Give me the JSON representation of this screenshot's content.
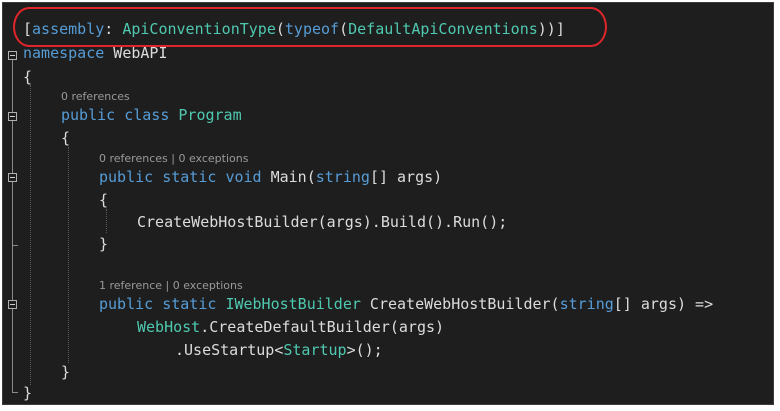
{
  "editor": {
    "line1": {
      "p1": "[",
      "p2": "assembly",
      "p3": ": ",
      "p4": "ApiConventionType",
      "p5": "(",
      "p6": "typeof",
      "p7": "(",
      "p8": "DefaultApiConventions",
      "p9": "))]"
    },
    "line2": {
      "p1": "namespace",
      "p2": " WebAPI"
    },
    "line3": "{",
    "lens_program": "0 references",
    "line4": {
      "p1": "public",
      "p2": " ",
      "p3": "class",
      "p4": " ",
      "p5": "Program"
    },
    "line5": "{",
    "lens_main": {
      "refs": "0 references",
      "sep": " | ",
      "exc": "0 exceptions"
    },
    "line6": {
      "p1": "public",
      "p2": " ",
      "p3": "static",
      "p4": " ",
      "p5": "void",
      "p6": " Main(",
      "p7": "string",
      "p8": "[] args)"
    },
    "line7": "{",
    "line8": "CreateWebHostBuilder(args).Build().Run();",
    "line9": "}",
    "lens_builder": {
      "refs": "1 reference",
      "sep": " | ",
      "exc": "0 exceptions"
    },
    "line10": {
      "p1": "public",
      "p2": " ",
      "p3": "static",
      "p4": " ",
      "p5": "IWebHostBuilder",
      "p6": " CreateWebHostBuilder(",
      "p7": "string",
      "p8": "[] args) =>"
    },
    "line11": {
      "p1": "WebHost",
      "p2": ".CreateDefaultBuilder(args)"
    },
    "line12": {
      "p1": ".UseStartup<",
      "p2": "Startup",
      "p3": ">();"
    },
    "line13": "}",
    "line14": "}"
  },
  "colors": {
    "background": "#1e1e1e",
    "keyword": "#569cd6",
    "type": "#4ec9b0",
    "text": "#dcdcdc",
    "codelens": "#9a9a9a",
    "annotation": "#e0262b"
  },
  "icons": [
    "collapse-icon"
  ]
}
